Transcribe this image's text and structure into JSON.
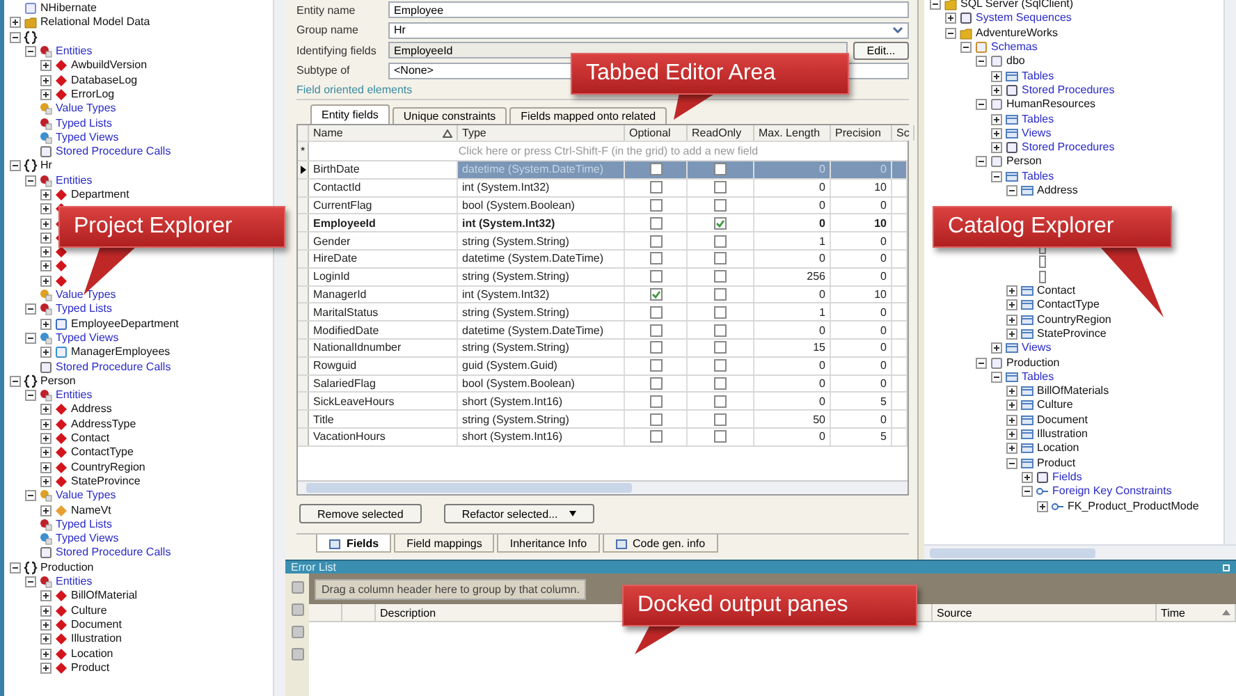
{
  "project_explorer": {
    "items": [
      {
        "label": "NHibernate",
        "kind": "nhibernate"
      },
      {
        "label": "Relational Model Data",
        "kind": "model",
        "expanded": false
      },
      {
        "kind": "group",
        "expanded": true,
        "children": [
          {
            "label": "Entities",
            "kind": "entities",
            "expanded": true,
            "children": [
              {
                "label": "AwbuildVersion",
                "kind": "entity",
                "expanded": false
              },
              {
                "label": "DatabaseLog",
                "kind": "entity",
                "expanded": false
              },
              {
                "label": "ErrorLog",
                "kind": "entity",
                "expanded": false
              }
            ]
          },
          {
            "label": "Value Types",
            "kind": "value-types"
          },
          {
            "label": "Typed Lists",
            "kind": "typed-lists"
          },
          {
            "label": "Typed Views",
            "kind": "typed-views"
          },
          {
            "label": "Stored Procedure Calls",
            "kind": "procs"
          }
        ]
      },
      {
        "label": "Hr",
        "kind": "group",
        "expanded": true,
        "children": [
          {
            "label": "Entities",
            "kind": "entities",
            "expanded": true,
            "children": [
              {
                "label": "Department",
                "kind": "entity",
                "expanded": false
              },
              {
                "kind": "entity",
                "expanded": false
              },
              {
                "kind": "entity",
                "expanded": false
              },
              {
                "kind": "entity",
                "expanded": false
              },
              {
                "kind": "entity",
                "expanded": false
              },
              {
                "kind": "entity",
                "expanded": false
              },
              {
                "kind": "entity",
                "expanded": false
              }
            ]
          },
          {
            "label": "Value Types",
            "kind": "value-types"
          },
          {
            "label": "Typed Lists",
            "kind": "typed-lists",
            "expanded": true,
            "children": [
              {
                "label": "EmployeeDepartment",
                "kind": "typed-list",
                "expanded": false
              }
            ]
          },
          {
            "label": "Typed Views",
            "kind": "typed-views",
            "expanded": true,
            "children": [
              {
                "label": "ManagerEmployees",
                "kind": "typed-view",
                "expanded": false
              }
            ]
          },
          {
            "label": "Stored Procedure Calls",
            "kind": "procs"
          }
        ]
      },
      {
        "label": "Person",
        "kind": "group",
        "expanded": true,
        "children": [
          {
            "label": "Entities",
            "kind": "entities",
            "expanded": true,
            "children": [
              {
                "label": "Address",
                "kind": "entity",
                "expanded": false
              },
              {
                "label": "AddressType",
                "kind": "entity",
                "expanded": false
              },
              {
                "label": "Contact",
                "kind": "entity",
                "expanded": false
              },
              {
                "label": "ContactType",
                "kind": "entity",
                "expanded": false
              },
              {
                "label": "CountryRegion",
                "kind": "entity",
                "expanded": false
              },
              {
                "label": "StateProvince",
                "kind": "entity",
                "expanded": false
              }
            ]
          },
          {
            "label": "Value Types",
            "kind": "value-types",
            "expanded": true,
            "children": [
              {
                "label": "NameVt",
                "kind": "value-type",
                "expanded": false
              }
            ]
          },
          {
            "label": "Typed Lists",
            "kind": "typed-lists"
          },
          {
            "label": "Typed Views",
            "kind": "typed-views"
          },
          {
            "label": "Stored Procedure Calls",
            "kind": "procs"
          }
        ]
      },
      {
        "label": "Production",
        "kind": "group",
        "expanded": true,
        "children": [
          {
            "label": "Entities",
            "kind": "entities",
            "expanded": true,
            "children": [
              {
                "label": "BillOfMaterial",
                "kind": "entity",
                "expanded": false
              },
              {
                "label": "Culture",
                "kind": "entity",
                "expanded": false
              },
              {
                "label": "Document",
                "kind": "entity",
                "expanded": false
              },
              {
                "label": "Illustration",
                "kind": "entity",
                "expanded": false
              },
              {
                "label": "Location",
                "kind": "entity",
                "expanded": false
              },
              {
                "label": "Product",
                "kind": "entity",
                "expanded": false
              }
            ]
          }
        ]
      }
    ]
  },
  "editor": {
    "form": [
      {
        "label": "Entity name",
        "value": "Employee",
        "kind": "text"
      },
      {
        "label": "Group name",
        "value": "Hr",
        "kind": "dropdown"
      },
      {
        "label": "Identifying fields",
        "value": "EmployeeId",
        "kind": "readonly",
        "button": "Edit..."
      },
      {
        "label": "Subtype of",
        "value": "<None>",
        "kind": "text"
      }
    ],
    "section": "Field oriented elements",
    "tabs": [
      {
        "label": "Entity fields",
        "selected": true
      },
      {
        "label": "Unique constraints",
        "selected": false
      },
      {
        "label": "Fields mapped onto related",
        "selected": false
      }
    ],
    "columns": [
      "Name",
      "Type",
      "Optional",
      "ReadOnly",
      "Max. Length",
      "Precision",
      "Sc"
    ],
    "new_row_marker": "*",
    "new_row_hint": "Click here or press Ctrl-Shift-F (in the grid) to add a new field",
    "fields": [
      {
        "name": "BirthDate",
        "type": "datetime (System.DateTime)",
        "optional": false,
        "readonly": false,
        "max_length": "0",
        "precision": "0",
        "selected": true,
        "identifying": false
      },
      {
        "name": "ContactId",
        "type": "int (System.Int32)",
        "optional": false,
        "readonly": false,
        "max_length": "0",
        "precision": "10",
        "selected": false,
        "identifying": false
      },
      {
        "name": "CurrentFlag",
        "type": "bool (System.Boolean)",
        "optional": false,
        "readonly": false,
        "max_length": "0",
        "precision": "0",
        "selected": false,
        "identifying": false
      },
      {
        "name": "EmployeeId",
        "type": "int (System.Int32)",
        "optional": false,
        "readonly": true,
        "max_length": "0",
        "precision": "10",
        "selected": false,
        "identifying": true
      },
      {
        "name": "Gender",
        "type": "string (System.String)",
        "optional": false,
        "readonly": false,
        "max_length": "1",
        "precision": "0",
        "selected": false,
        "identifying": false
      },
      {
        "name": "HireDate",
        "type": "datetime (System.DateTime)",
        "optional": false,
        "readonly": false,
        "max_length": "0",
        "precision": "0",
        "selected": false,
        "identifying": false
      },
      {
        "name": "LoginId",
        "type": "string (System.String)",
        "optional": false,
        "readonly": false,
        "max_length": "256",
        "precision": "0",
        "selected": false,
        "identifying": false
      },
      {
        "name": "ManagerId",
        "type": "int (System.Int32)",
        "optional": true,
        "readonly": false,
        "max_length": "0",
        "precision": "10",
        "selected": false,
        "identifying": false
      },
      {
        "name": "MaritalStatus",
        "type": "string (System.String)",
        "optional": false,
        "readonly": false,
        "max_length": "1",
        "precision": "0",
        "selected": false,
        "identifying": false
      },
      {
        "name": "ModifiedDate",
        "type": "datetime (System.DateTime)",
        "optional": false,
        "readonly": false,
        "max_length": "0",
        "precision": "0",
        "selected": false,
        "identifying": false
      },
      {
        "name": "NationalIdnumber",
        "type": "string (System.String)",
        "optional": false,
        "readonly": false,
        "max_length": "15",
        "precision": "0",
        "selected": false,
        "identifying": false
      },
      {
        "name": "Rowguid",
        "type": "guid (System.Guid)",
        "optional": false,
        "readonly": false,
        "max_length": "0",
        "precision": "0",
        "selected": false,
        "identifying": false
      },
      {
        "name": "SalariedFlag",
        "type": "bool (System.Boolean)",
        "optional": false,
        "readonly": false,
        "max_length": "0",
        "precision": "0",
        "selected": false,
        "identifying": false
      },
      {
        "name": "SickLeaveHours",
        "type": "short (System.Int16)",
        "optional": false,
        "readonly": false,
        "max_length": "0",
        "precision": "5",
        "selected": false,
        "identifying": false
      },
      {
        "name": "Title",
        "type": "string (System.String)",
        "optional": false,
        "readonly": false,
        "max_length": "50",
        "precision": "0",
        "selected": false,
        "identifying": false
      },
      {
        "name": "VacationHours",
        "type": "short (System.Int16)",
        "optional": false,
        "readonly": false,
        "max_length": "0",
        "precision": "5",
        "selected": false,
        "identifying": false
      }
    ],
    "buttons": [
      {
        "label": "Remove selected",
        "kind": "plain"
      },
      {
        "label": "Refactor selected...",
        "kind": "split"
      }
    ],
    "bottom_tabs": [
      {
        "label": "Fields",
        "selected": true,
        "icon": true
      },
      {
        "label": "Field mappings",
        "selected": false,
        "icon": false
      },
      {
        "label": "Inheritance Info",
        "selected": false,
        "icon": false
      },
      {
        "label": "Code gen. info",
        "selected": false,
        "icon": true
      }
    ]
  },
  "catalog_explorer": {
    "items": [
      {
        "label": "SQL Server (SqlClient)",
        "kind": "server",
        "expanded": true,
        "children": [
          {
            "label": "System Sequences",
            "kind": "sequences",
            "expanded": false
          },
          {
            "label": "AdventureWorks",
            "kind": "database",
            "expanded": true,
            "children": [
              {
                "label": "Schemas",
                "kind": "schemas",
                "expanded": true,
                "children": [
                  {
                    "label": "dbo",
                    "kind": "schema",
                    "expanded": true,
                    "children": [
                      {
                        "label": "Tables",
                        "kind": "tables",
                        "expanded": false
                      },
                      {
                        "label": "Stored Procedures",
                        "kind": "procedures",
                        "expanded": false
                      }
                    ]
                  },
                  {
                    "label": "HumanResources",
                    "kind": "schema",
                    "expanded": true,
                    "children": [
                      {
                        "label": "Tables",
                        "kind": "tables",
                        "expanded": false
                      },
                      {
                        "label": "Views",
                        "kind": "views",
                        "expanded": false
                      },
                      {
                        "label": "Stored Procedures",
                        "kind": "procedures",
                        "expanded": false
                      }
                    ]
                  },
                  {
                    "label": "Person",
                    "kind": "schema",
                    "expanded": true,
                    "children": [
                      {
                        "label": "Tables",
                        "kind": "tables",
                        "expanded": true,
                        "children": [
                          {
                            "label": "Address",
                            "kind": "table",
                            "expanded": true,
                            "children": [
                              {
                                "kind": "hidden"
                              },
                              {
                                "kind": "hidden"
                              },
                              {
                                "kind": "hidden"
                              },
                              {
                                "kind": "field"
                              },
                              {
                                "kind": "field"
                              },
                              {
                                "kind": "field"
                              }
                            ]
                          },
                          {
                            "label": "Contact",
                            "kind": "table",
                            "expanded": false
                          },
                          {
                            "label": "ContactType",
                            "kind": "table",
                            "expanded": false
                          },
                          {
                            "label": "CountryRegion",
                            "kind": "table",
                            "expanded": false
                          },
                          {
                            "label": "StateProvince",
                            "kind": "table",
                            "expanded": false
                          }
                        ]
                      },
                      {
                        "label": "Views",
                        "kind": "views",
                        "expanded": false
                      }
                    ]
                  },
                  {
                    "label": "Production",
                    "kind": "schema",
                    "expanded": true,
                    "children": [
                      {
                        "label": "Tables",
                        "kind": "tables",
                        "expanded": true,
                        "children": [
                          {
                            "label": "BillOfMaterials",
                            "kind": "table",
                            "expanded": false
                          },
                          {
                            "label": "Culture",
                            "kind": "table",
                            "expanded": false
                          },
                          {
                            "label": "Document",
                            "kind": "table",
                            "expanded": false
                          },
                          {
                            "label": "Illustration",
                            "kind": "table",
                            "expanded": false
                          },
                          {
                            "label": "Location",
                            "kind": "table",
                            "expanded": false
                          },
                          {
                            "label": "Product",
                            "kind": "table",
                            "expanded": true,
                            "children": [
                              {
                                "label": "Fields",
                                "kind": "fields",
                                "expanded": false
                              },
                              {
                                "label": "Foreign Key Constraints",
                                "kind": "fks",
                                "expanded": true,
                                "children": [
                                  {
                                    "label": "FK_Product_ProductMode",
                                    "kind": "fk",
                                    "expanded": false
                                  }
                                ]
                              }
                            ]
                          }
                        ]
                      }
                    ]
                  }
                ]
              }
            ]
          }
        ]
      }
    ]
  },
  "error_list": {
    "title": "Error List",
    "group_hint": "Drag a column header here to group by that column.",
    "columns": [
      "Description",
      "Source",
      "Time"
    ]
  },
  "callouts": [
    {
      "text": "Tabbed Editor  Area"
    },
    {
      "text": "Project Explorer"
    },
    {
      "text": "Catalog Explorer"
    },
    {
      "text": "Docked output panes"
    }
  ]
}
